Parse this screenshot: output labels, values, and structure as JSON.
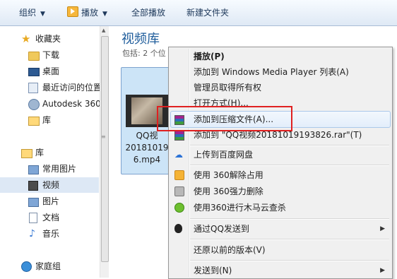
{
  "toolbar": {
    "organize_label": "组织",
    "play_label": "播放",
    "play_all_label": "全部播放",
    "new_folder_label": "新建文件夹"
  },
  "sidebar": {
    "items": [
      {
        "label": "收藏夹",
        "icon": "star-icon"
      },
      {
        "label": "下载",
        "icon": "folder-icon"
      },
      {
        "label": "桌面",
        "icon": "desktop-icon"
      },
      {
        "label": "最近访问的位置",
        "icon": "recent-places-icon"
      },
      {
        "label": "Autodesk 360",
        "icon": "autodesk-icon"
      },
      {
        "label": "库",
        "icon": "library-icon"
      },
      {
        "label": "库",
        "icon": "library-icon"
      },
      {
        "label": "常用图片",
        "icon": "pictures-icon"
      },
      {
        "label": "视频",
        "icon": "video-icon",
        "selected": true
      },
      {
        "label": "图片",
        "icon": "pictures-icon"
      },
      {
        "label": "文档",
        "icon": "document-icon"
      },
      {
        "label": "音乐",
        "icon": "music-icon"
      },
      {
        "label": "家庭组",
        "icon": "homegroup-icon"
      }
    ]
  },
  "main": {
    "title": "视频库",
    "subtitle": "包括: 2 个位",
    "file": {
      "name_lines": [
        "QQ视",
        "20181019",
        "6.mp4"
      ]
    }
  },
  "context_menu": {
    "items": [
      {
        "label": "播放(P)",
        "bold": true
      },
      {
        "label": "添加到 Windows Media Player 列表(A)"
      },
      {
        "label": "管理员取得所有权"
      },
      {
        "label": "打开方式(H)..."
      },
      {
        "label": "添加到压缩文件(A)...",
        "icon": "winrar-icon",
        "highlighted": true
      },
      {
        "label": "添加到 \"QQ视频20181019193826.rar\"(T)",
        "icon": "winrar-icon"
      },
      {
        "label": "上传到百度网盘",
        "icon": "baidu-cloud-icon"
      },
      {
        "label": "使用 360解除占用",
        "icon": "360-unlock-icon"
      },
      {
        "label": "使用 360强力删除",
        "icon": "360-delete-icon"
      },
      {
        "label": "使用360进行木马云查杀",
        "icon": "360-scan-icon"
      },
      {
        "label": "通过QQ发送到",
        "icon": "qq-icon",
        "submenu": true
      },
      {
        "label": "还原以前的版本(V)"
      },
      {
        "label": "发送到(N)",
        "submenu": true
      }
    ]
  },
  "colors": {
    "highlight_box": "#e02020",
    "title_blue": "#1e5c9b",
    "selection_bg": "#cce4f7"
  }
}
